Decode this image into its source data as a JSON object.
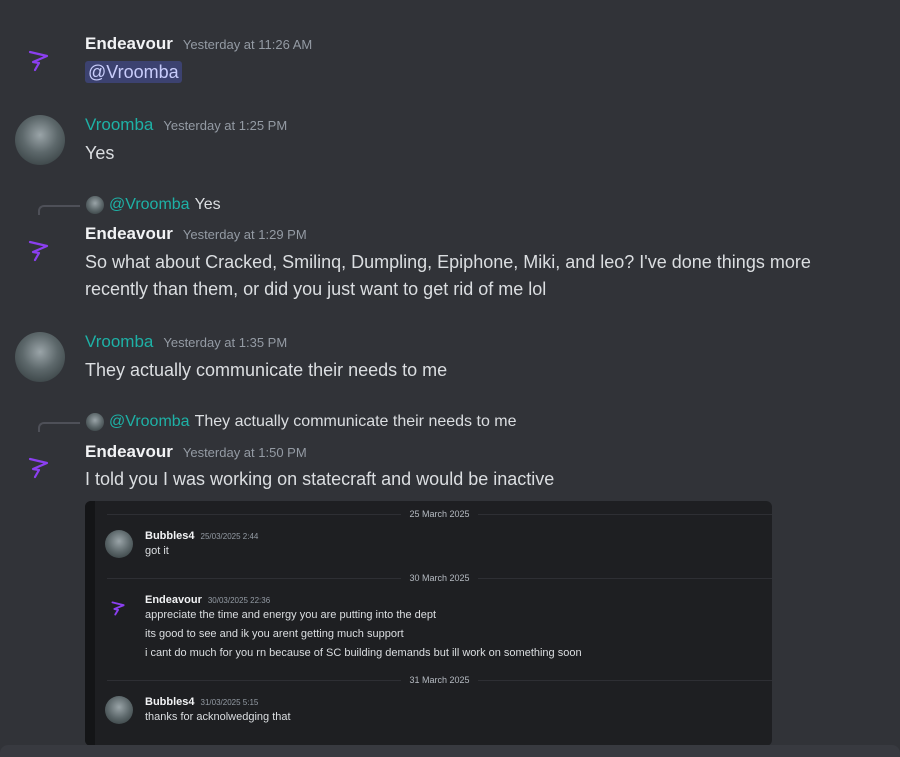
{
  "messages": [
    {
      "user": "Endeavour",
      "time": "Yesterday at 11:26 AM",
      "mention": "@Vroomba",
      "avatar": "pointer-logo-icon"
    },
    {
      "user": "Vroomba",
      "time": "Yesterday at 1:25 PM",
      "text": "Yes",
      "avatar": "user-photo-avatar"
    },
    {
      "reply": {
        "mention": "@Vroomba",
        "text": "Yes"
      },
      "user": "Endeavour",
      "time": "Yesterday at 1:29 PM",
      "text": "So what about Cracked, Smilinq, Dumpling, Epiphone, Miki, and leo? I've done things more recently than them, or did you just want to get rid of me lol"
    },
    {
      "user": "Vroomba",
      "time": "Yesterday at 1:35 PM",
      "text": "They actually communicate their needs to me"
    },
    {
      "reply": {
        "mention": "@Vroomba",
        "text": "They actually communicate their needs to me"
      },
      "user": "Endeavour",
      "time": "Yesterday at 1:50 PM",
      "text": "I told you I was working on statecraft and would be inactive"
    }
  ],
  "embed": {
    "dividers": [
      "25 March 2025",
      "30 March 2025",
      "31 March 2025"
    ],
    "messages": [
      {
        "user": "Bubbles4",
        "time": "25/03/2025 2:44",
        "lines": [
          "got it"
        ]
      },
      {
        "user": "Endeavour",
        "time": "30/03/2025 22:36",
        "lines": [
          "appreciate the time and energy you are putting into the dept",
          "its good to see and ik you arent getting much support",
          "i cant do much for you rn because of SC building demands but ill work on something soon"
        ]
      },
      {
        "user": "Bubbles4",
        "time": "31/03/2025 5:15",
        "lines": [
          "thanks for acknolwedging that"
        ]
      }
    ]
  },
  "colors": {
    "background": "#313338",
    "teal_username": "#1eb1a6",
    "mention_bg": "#3c4270",
    "endeavour_logo": "#8b3ff0"
  }
}
